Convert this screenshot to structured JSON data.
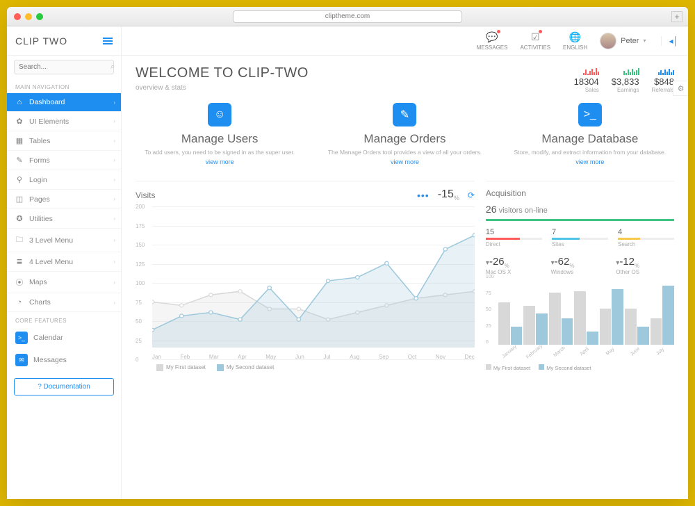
{
  "browser": {
    "url": "cliptheme.com"
  },
  "brand": "CLIP TWO",
  "search": {
    "placeholder": "Search..."
  },
  "nav": {
    "main_label": "MAIN NAVIGATION",
    "items": [
      {
        "label": "Dashboard",
        "icon": "⌂",
        "active": true
      },
      {
        "label": "UI Elements",
        "icon": "✿"
      },
      {
        "label": "Tables",
        "icon": "▦"
      },
      {
        "label": "Forms",
        "icon": "✎"
      },
      {
        "label": "Login",
        "icon": "⚲"
      },
      {
        "label": "Pages",
        "icon": "◫"
      },
      {
        "label": "Utilities",
        "icon": "✪"
      },
      {
        "label": "3 Level Menu",
        "icon": "🗀"
      },
      {
        "label": "4 Level Menu",
        "icon": "≣"
      },
      {
        "label": "Maps",
        "icon": "⦿"
      },
      {
        "label": "Charts",
        "icon": "◔"
      }
    ],
    "core_label": "CORE FEATURES",
    "core": [
      {
        "label": "Calendar",
        "icon": ">_"
      },
      {
        "label": "Messages",
        "icon": "✉"
      }
    ],
    "doc_btn": "? Documentation"
  },
  "topbar": {
    "messages": "MESSAGES",
    "activities": "ACTIVITIES",
    "english": "ENGLISH",
    "user": "Peter"
  },
  "page": {
    "title": "WELCOME TO CLIP-TWO",
    "subtitle": "overview & stats"
  },
  "kpis": [
    {
      "value": "18304",
      "label": "Sales",
      "spark": [
        3,
        8,
        2,
        6,
        9,
        4,
        10,
        5
      ]
    },
    {
      "value": "$3,833",
      "label": "Earnings",
      "spark": [
        6,
        3,
        8,
        4,
        9,
        5,
        7,
        10
      ]
    },
    {
      "value": "$848",
      "label": "Referrals",
      "spark": [
        4,
        7,
        3,
        8,
        5,
        9,
        4,
        7
      ]
    }
  ],
  "tiles": [
    {
      "title": "Manage Users",
      "desc": "To add users, you need to be signed in as the super user.",
      "link": "view more",
      "icon": "☺"
    },
    {
      "title": "Manage Orders",
      "desc": "The Manage Orders tool provides a view of all your orders.",
      "link": "view more",
      "icon": "✎"
    },
    {
      "title": "Manage Database",
      "desc": "Store, modify, and extract information from your database.",
      "link": "view more",
      "icon": ">_"
    }
  ],
  "visits": {
    "title": "Visits",
    "delta": "-15",
    "delta_unit": "%"
  },
  "acq": {
    "title": "Acquisition",
    "visitors_count": "26",
    "visitors_label": "visitors on-line",
    "sources": [
      {
        "count": "15",
        "label": "Direct",
        "color": "#ff5b5b",
        "pct": 60
      },
      {
        "count": "7",
        "label": "Sites",
        "color": "#4ec3e8",
        "pct": 50
      },
      {
        "count": "4",
        "label": "Search",
        "color": "#f7c94b",
        "pct": 40
      }
    ],
    "os": [
      {
        "value": "-26",
        "label": "Mac OS X"
      },
      {
        "value": "-62",
        "label": "Windows"
      },
      {
        "value": "-12",
        "label": "Other OS"
      }
    ]
  },
  "chart_data": [
    {
      "type": "line",
      "title": "Visits",
      "ylim": [
        0,
        200
      ],
      "yticks": [
        0,
        25,
        50,
        75,
        100,
        125,
        150,
        175,
        200
      ],
      "categories": [
        "Jan",
        "Feb",
        "Mar",
        "Apr",
        "May",
        "Jun",
        "Jul",
        "Aug",
        "Sep",
        "Oct",
        "Nov",
        "Dec"
      ],
      "series": [
        {
          "name": "My First dataset",
          "color": "#d8d8d8",
          "values": [
            65,
            60,
            75,
            80,
            55,
            55,
            40,
            50,
            60,
            70,
            75,
            80
          ]
        },
        {
          "name": "My Second dataset",
          "color": "#9ec8dc",
          "values": [
            25,
            45,
            50,
            40,
            85,
            40,
            95,
            100,
            120,
            70,
            140,
            160
          ]
        }
      ]
    },
    {
      "type": "bar",
      "title": "Acquisition",
      "ylim": [
        0,
        100
      ],
      "yticks": [
        0,
        25,
        50,
        75,
        100
      ],
      "categories": [
        "January",
        "February",
        "March",
        "April",
        "May",
        "June",
        "July"
      ],
      "series": [
        {
          "name": "My First dataset",
          "color": "#d8d8d8",
          "values": [
            65,
            60,
            80,
            82,
            55,
            55,
            40
          ]
        },
        {
          "name": "My Second dataset",
          "color": "#9ec8dc",
          "values": [
            28,
            48,
            40,
            20,
            85,
            28,
            90
          ]
        }
      ]
    }
  ]
}
